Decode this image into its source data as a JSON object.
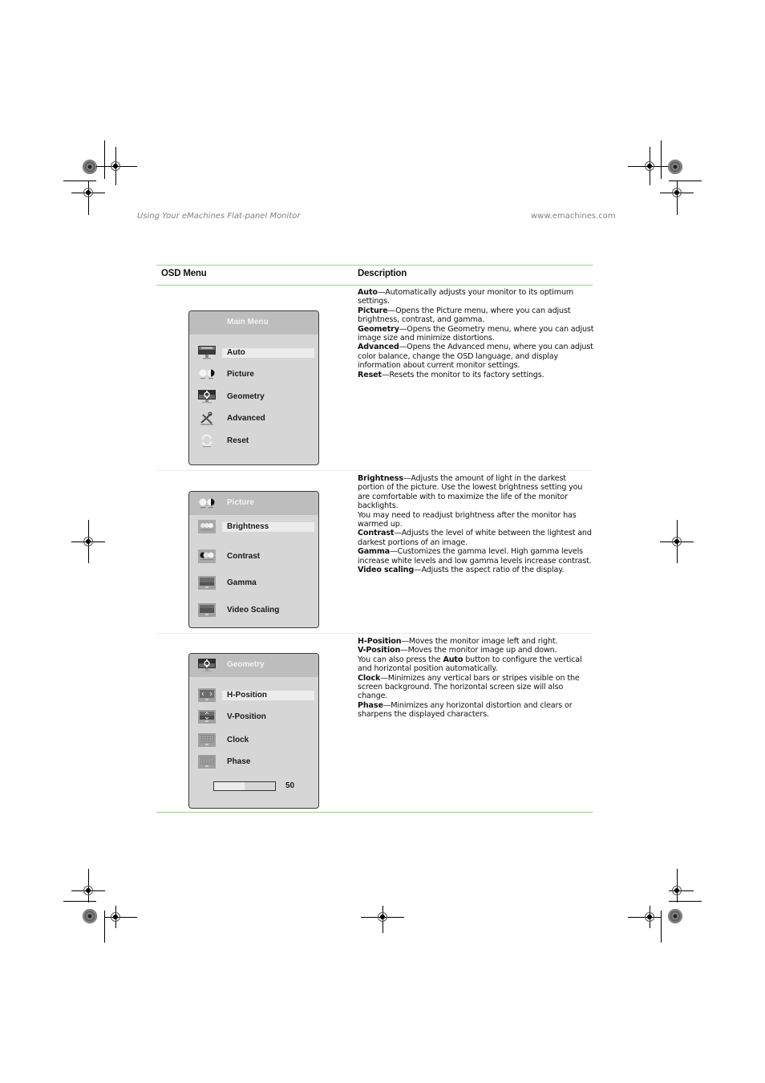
{
  "header": {
    "left": "Using Your eMachines Flat-panel Monitor",
    "right": "www.emachines.com"
  },
  "table": {
    "columns": [
      "OSD Menu",
      "Description"
    ],
    "rows": [
      {
        "osd": {
          "title": "Main Menu",
          "items": [
            {
              "label": "Auto",
              "icon": "auto-monitor-icon",
              "selected": true
            },
            {
              "label": "Picture",
              "icon": "picture-icon",
              "selected": false
            },
            {
              "label": "Geometry",
              "icon": "geometry-icon",
              "selected": false
            },
            {
              "label": "Advanced",
              "icon": "advanced-tools-icon",
              "selected": false
            },
            {
              "label": "Reset",
              "icon": "reset-icon",
              "selected": false
            }
          ]
        },
        "description": [
          {
            "term": "Auto",
            "text": "—Automatically adjusts your monitor to its optimum settings."
          },
          {
            "term": "Picture",
            "text": "—Opens the Picture menu, where you can adjust brightness, contrast, and gamma."
          },
          {
            "term": "Geometry",
            "text": "—Opens the Geometry menu, where you can adjust image size and minimize distortions."
          },
          {
            "term": "Advanced",
            "text": "—Opens the Advanced menu, where you can adjust color balance, change the OSD language, and display information about current monitor settings."
          },
          {
            "term": "Reset",
            "text": "—Resets the monitor to its factory settings."
          }
        ]
      },
      {
        "osd": {
          "title": "Picture",
          "title_icon": "picture-icon",
          "items": [
            {
              "label": "Brightness",
              "icon": "brightness-icon",
              "selected": true
            },
            {
              "label": "Contrast",
              "icon": "contrast-icon",
              "selected": false
            },
            {
              "label": "Gamma",
              "icon": "gamma-icon",
              "selected": false
            },
            {
              "label": "Video Scaling",
              "icon": "video-scaling-icon",
              "selected": false
            }
          ]
        },
        "description": [
          {
            "term": "Brightness",
            "text": "—Adjusts the amount of light in the darkest portion of the picture. Use the lowest brightness setting you are comfortable with to maximize the life of the monitor backlights."
          },
          {
            "term": "",
            "text": "You may need to readjust brightness after the monitor has warmed up."
          },
          {
            "term": "Contrast",
            "text": "—Adjusts the level of white between the lightest and darkest portions of an image."
          },
          {
            "term": "Gamma",
            "text": "—Customizes the gamma level. High gamma levels increase white levels and low gamma levels increase contrast."
          },
          {
            "term": "Video scaling",
            "text": "—Adjusts the aspect ratio of the display."
          }
        ]
      },
      {
        "osd": {
          "title": "Geometry",
          "title_icon": "geometry-icon",
          "items": [
            {
              "label": "H-Position",
              "icon": "h-position-icon",
              "selected": true
            },
            {
              "label": "V-Position",
              "icon": "v-position-icon",
              "selected": false
            },
            {
              "label": "Clock",
              "icon": "clock-icon",
              "selected": false
            },
            {
              "label": "Phase",
              "icon": "phase-icon",
              "selected": false
            }
          ],
          "slider": {
            "value": 50,
            "display": "50",
            "max": 100
          }
        },
        "description": [
          {
            "term": "H-Position",
            "text": "—Moves the monitor image left and right."
          },
          {
            "term": "V-Position",
            "text": "—Moves the monitor image up and down."
          },
          {
            "term": "",
            "text": "You can also press the ",
            "inline_bold": "Auto",
            "text_after": " button to configure the vertical and horizontal position automatically."
          },
          {
            "term": "Clock",
            "text": "—Minimizes any vertical bars or stripes visible on the screen background. The horizontal screen size will also change."
          },
          {
            "term": "Phase",
            "text": "—Minimizes any horizontal distortion and clears or sharpens the displayed characters."
          }
        ]
      }
    ]
  },
  "colors": {
    "rule_green": "#9ad48a",
    "osd_bg": "#d6d6d6",
    "osd_header": "#bdbdbd",
    "osd_selection": "#ececec"
  }
}
